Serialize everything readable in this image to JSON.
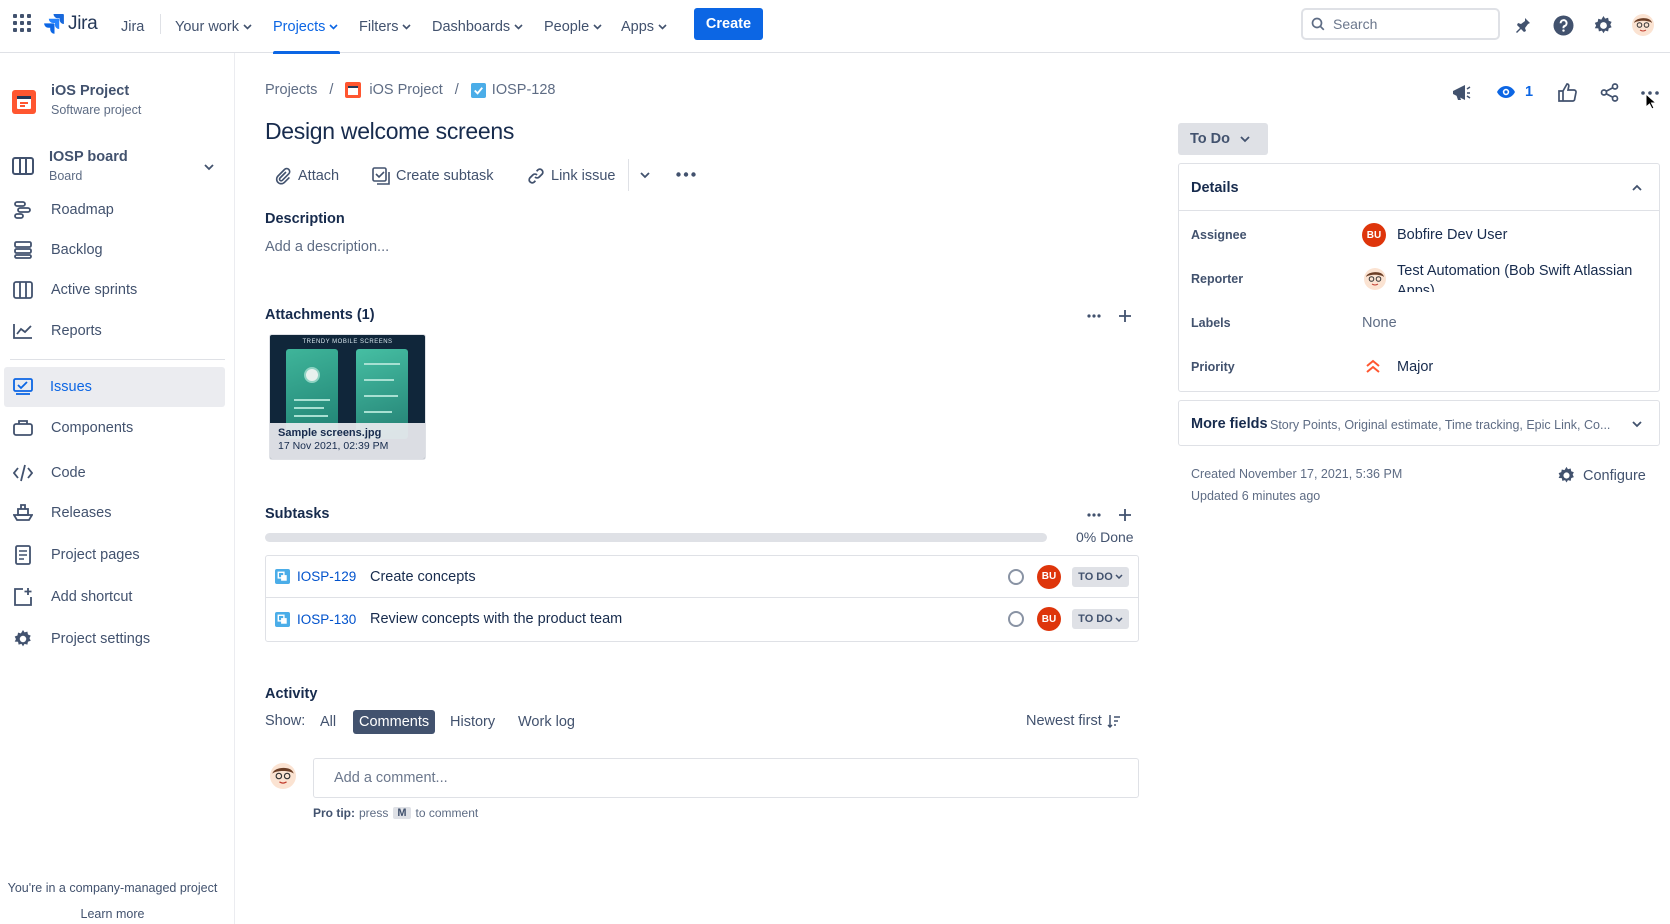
{
  "topbar": {
    "product": "Jira",
    "nav": [
      {
        "label": "Your work"
      },
      {
        "label": "Projects"
      },
      {
        "label": "Filters"
      },
      {
        "label": "Dashboards"
      },
      {
        "label": "People"
      },
      {
        "label": "Apps"
      }
    ],
    "create_label": "Create",
    "search_placeholder": "Search"
  },
  "sidebar": {
    "project_name": "iOS Project",
    "project_type": "Software project",
    "board_name": "IOSP board",
    "board_type": "Board",
    "items": [
      {
        "label": "Roadmap",
        "icon": "roadmap-icon"
      },
      {
        "label": "Backlog",
        "icon": "backlog-icon"
      },
      {
        "label": "Active sprints",
        "icon": "board-icon"
      },
      {
        "label": "Reports",
        "icon": "chart-icon"
      },
      {
        "label": "Issues",
        "icon": "issues-icon"
      },
      {
        "label": "Components",
        "icon": "components-icon"
      },
      {
        "label": "Code",
        "icon": "code-icon"
      },
      {
        "label": "Releases",
        "icon": "ship-icon"
      },
      {
        "label": "Project pages",
        "icon": "page-icon"
      },
      {
        "label": "Add shortcut",
        "icon": "add-shortcut-icon"
      },
      {
        "label": "Project settings",
        "icon": "gear-icon"
      }
    ],
    "footer_text": "You're in a company-managed project",
    "learn_more": "Learn more"
  },
  "breadcrumb": {
    "projects": "Projects",
    "project": "iOS Project",
    "issue_key": "IOSP-128"
  },
  "issue": {
    "title": "Design welcome screens",
    "watchers": "1"
  },
  "toolbar": {
    "attach": "Attach",
    "create_subtask": "Create subtask",
    "link_issue": "Link issue"
  },
  "description": {
    "heading": "Description",
    "placeholder": "Add a description..."
  },
  "attachments": {
    "heading": "Attachments (1)",
    "file_name": "Sample screens.jpg",
    "file_date": "17 Nov 2021, 02:39 PM",
    "thumb_caption": "TRENDY MOBILE SCREENS"
  },
  "subtasks": {
    "heading": "Subtasks",
    "progress_percent": 0,
    "progress_label": "0% Done",
    "rows": [
      {
        "key": "IOSP-129",
        "summary": "Create concepts",
        "assignee_initials": "BU",
        "status": "TO DO"
      },
      {
        "key": "IOSP-130",
        "summary": "Review concepts with the product team",
        "assignee_initials": "BU",
        "status": "TO DO"
      }
    ]
  },
  "activity": {
    "heading": "Activity",
    "show_label": "Show:",
    "tabs": [
      "All",
      "Comments",
      "History",
      "Work log"
    ],
    "active_tab": "Comments",
    "sort_label": "Newest first",
    "comment_placeholder": "Add a comment...",
    "pro_tip_label": "Pro tip:",
    "pro_tip_press": "press",
    "pro_tip_key": "M",
    "pro_tip_suffix": "to comment"
  },
  "details": {
    "status": "To Do",
    "heading": "Details",
    "assignee_label": "Assignee",
    "assignee": "Bobfire Dev User",
    "assignee_initials": "BU",
    "reporter_label": "Reporter",
    "reporter": "Test Automation (Bob Swift Atlassian Apps)",
    "labels_label": "Labels",
    "labels": "None",
    "priority_label": "Priority",
    "priority": "Major",
    "more_fields": "More fields",
    "more_fields_hint": "Story Points, Original estimate, Time tracking, Epic Link, Co...",
    "created": "Created November 17, 2021, 5:36 PM",
    "updated": "Updated 6 minutes ago",
    "configure": "Configure"
  },
  "colors": {
    "brand": "#0c66e4",
    "avatar_bu": "#de350b",
    "priority": "#ff5630"
  }
}
